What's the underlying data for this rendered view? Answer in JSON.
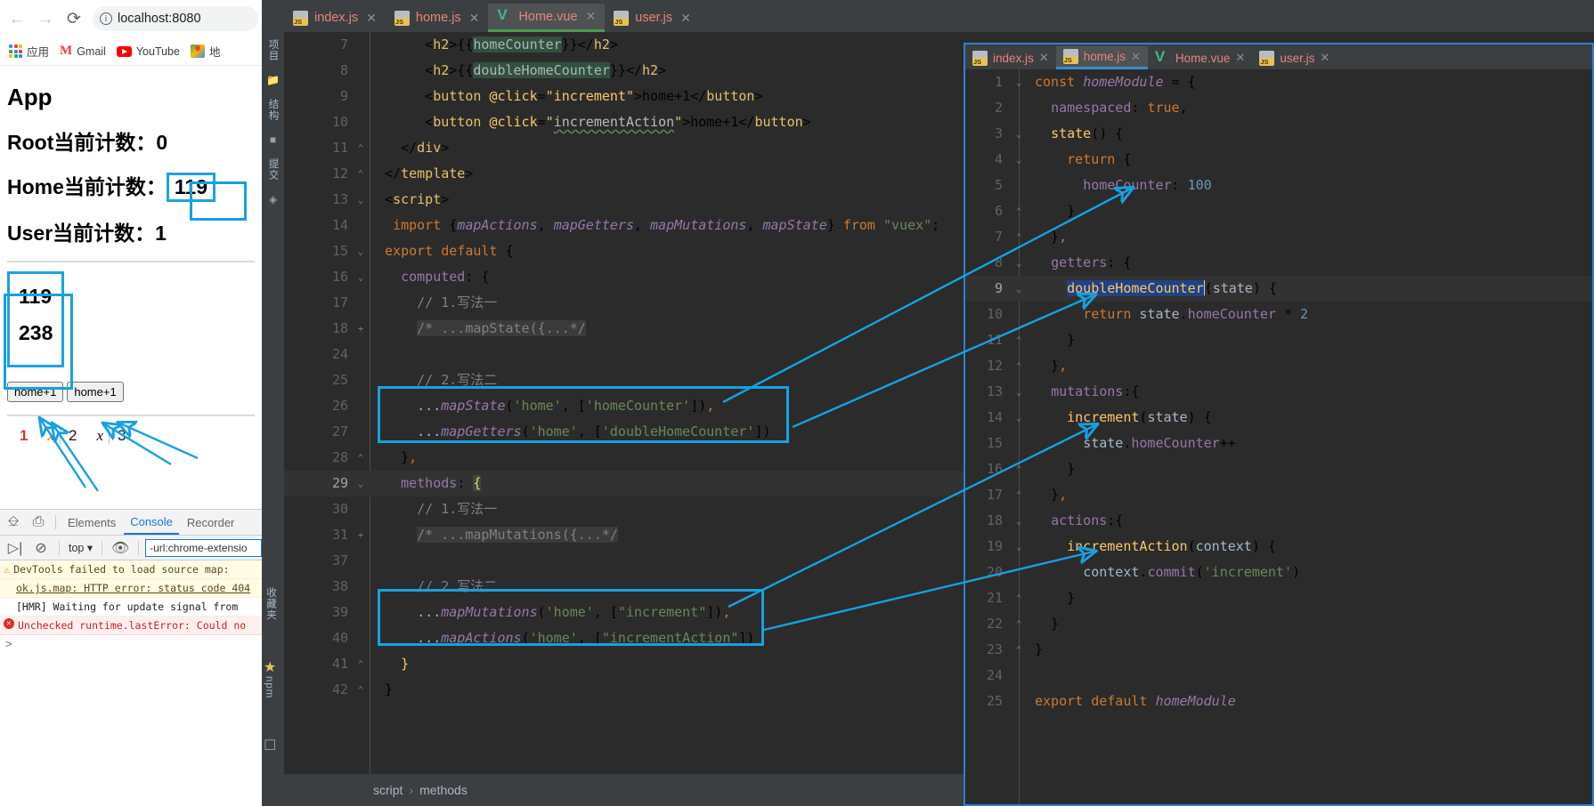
{
  "browser": {
    "nav": {
      "back": "←",
      "forward": "→",
      "reload": "⟳"
    },
    "omnibox": {
      "url": "localhost:8080",
      "info_icon": "info-icon"
    },
    "bookmarks": [
      {
        "label": "应用",
        "icon": "apps-grid-icon"
      },
      {
        "label": "Gmail",
        "icon": "gmail-icon"
      },
      {
        "label": "YouTube",
        "icon": "youtube-icon"
      },
      {
        "label": "地",
        "icon": "google-maps-icon"
      }
    ]
  },
  "page": {
    "app_title": "App",
    "root_counter_label": "Root当前计数：",
    "root_counter_value": "0",
    "home_counter_label": "Home当前计数：",
    "home_counter_value": "119",
    "user_counter_label": "User当前计数：",
    "user_counter_value": "1",
    "home_counter_display": "119",
    "double_home_counter_display": "238",
    "button_1": "home+1",
    "button_2": "home+1",
    "pager": {
      "p1": "1",
      "x1": "x",
      "p2": "2",
      "x2": "x",
      "p3": "3"
    }
  },
  "devtools": {
    "tabs": [
      "Elements",
      "Console",
      "Recorder"
    ],
    "active_tab": "Console",
    "context": "top",
    "filter_value": "-url:chrome-extensio",
    "logs": [
      {
        "level": "warning",
        "text": "DevTools failed to load source map:",
        "text2": "ok.js.map: HTTP error: status code 404"
      },
      {
        "level": "info",
        "text": "[HMR] Waiting for update signal from"
      },
      {
        "level": "error",
        "text": "Unchecked runtime.lastError: Could no"
      }
    ],
    "prompt": ">"
  },
  "ide": {
    "toolstrip": [
      "项目",
      "结构",
      "提交"
    ],
    "right_strip": [
      "收藏夹",
      "npm"
    ],
    "tabs": [
      {
        "label": "index.js",
        "icon": "js-file-icon",
        "active": false
      },
      {
        "label": "home.js",
        "icon": "js-file-icon",
        "active": false
      },
      {
        "label": "Home.vue",
        "icon": "vue-file-icon",
        "active": true
      },
      {
        "label": "user.js",
        "icon": "js-file-icon",
        "active": false
      }
    ],
    "breadcrumb": [
      "script",
      "methods"
    ],
    "editor_lines": [
      {
        "n": "7",
        "fold": "",
        "html": "      &lt;<span class='tag'>h2</span>&gt;{{<span class='id hl-green'>homeCounter</span>}}&lt;/<span class='tag'>h2</span>&gt;"
      },
      {
        "n": "8",
        "fold": "",
        "html": "      &lt;<span class='tag'>h2</span>&gt;{{<span class='id hl-green'>doubleHomeCounter</span>}}&lt;/<span class='tag'>h2</span>&gt;"
      },
      {
        "n": "9",
        "fold": "",
        "html": "      &lt;<span class='tag'>button</span> <span class='fn'>@click</span>=<span class='tag'>\"</span><span class='fn'>increment</span><span class='tag'>\"</span>&gt;home+1&lt;/<span class='tag'>button</span>&gt;"
      },
      {
        "n": "10",
        "fold": "",
        "html": "      &lt;<span class='tag'>button</span> <span class='fn'>@click</span>=<span class='tag'>\"</span><span class='attr squig'>incrementAction</span><span class='tag'>\"</span>&gt;home+1&lt;/<span class='tag'>button</span>&gt;"
      },
      {
        "n": "11",
        "fold": "⌃",
        "html": "   &lt;/<span class='tag'>div</span>&gt;"
      },
      {
        "n": "12",
        "fold": "⌃",
        "html": " &lt;/<span class='tag'>template</span>&gt;"
      },
      {
        "n": "13",
        "fold": "⌄",
        "html": " &lt;<span class='tag'>script</span>&gt;"
      },
      {
        "n": "14",
        "fold": "",
        "html": "  <span class='k'>import</span> {<span class='prop itl'>mapActions</span>, <span class='prop itl'>mapGetters</span>, <span class='prop itl'>mapMutations</span>, <span class='prop itl'>mapState</span>} <span class='k'>from</span> <span class='str'>\"vuex\"</span>;"
      },
      {
        "n": "15",
        "fold": "⌄",
        "html": " <span class='k'>export default</span> {"
      },
      {
        "n": "16",
        "fold": "⌄",
        "html": "   <span class='prop'>computed</span>: {"
      },
      {
        "n": "17",
        "fold": "",
        "html": "     <span class='cmt'>// 1.写法一</span>"
      },
      {
        "n": "18",
        "fold": "+",
        "html": "     <span class='cmt hl-grey'>/* ...mapState({...*/</span>"
      },
      {
        "n": "24",
        "fold": "",
        "html": ""
      },
      {
        "n": "25",
        "fold": "",
        "html": "     <span class='cmt'>// 2.写法二</span>"
      },
      {
        "n": "26",
        "fold": "",
        "html": "     <span class='id'>...</span><span class='prop itl'>mapState</span>(<span class='str'>'home'</span>, [<span class='str'>'homeCounter'</span>])<span class='k'>,</span>"
      },
      {
        "n": "27",
        "fold": "",
        "html": "     <span class='id'>...</span><span class='prop itl'>mapGetters</span>(<span class='str'>'home'</span>, [<span class='str'>'doubleHomeCounter'</span>])"
      },
      {
        "n": "28",
        "fold": "⌃",
        "html": "   }<span class='k'>,</span>"
      },
      {
        "n": "29",
        "fold": "⌄",
        "html": "   <span class='prop'>methods</span>: <span class='fn' style='background:#3a4a3a'>{</span>",
        "current": true
      },
      {
        "n": "30",
        "fold": "",
        "html": "     <span class='cmt'>// 1.写法一</span>"
      },
      {
        "n": "31",
        "fold": "+",
        "html": "     <span class='cmt hl-grey'>/* ...mapMutations({...*/</span>"
      },
      {
        "n": "37",
        "fold": "",
        "html": ""
      },
      {
        "n": "38",
        "fold": "",
        "html": "     <span class='cmt'>// 2.写法二</span>"
      },
      {
        "n": "39",
        "fold": "",
        "html": "     <span class='id'>...</span><span class='prop itl'>mapMutations</span>(<span class='str'>'home'</span>, [<span class='str'>\"increment\"</span>])<span class='k'>,</span>"
      },
      {
        "n": "40",
        "fold": "",
        "html": "     <span class='id'>...</span><span class='prop itl'>mapActions</span>(<span class='str'>'home'</span>, [<span class='str'>\"incrementAction\"</span>])"
      },
      {
        "n": "41",
        "fold": "⌃",
        "html": "   <span class='fn'>}</span>"
      },
      {
        "n": "42",
        "fold": "⌃",
        "html": " }"
      }
    ]
  },
  "floating_window": {
    "tabs": [
      {
        "label": "index.js",
        "icon": "js-file-icon",
        "active": false
      },
      {
        "label": "home.js",
        "icon": "js-file-icon",
        "active": true
      },
      {
        "label": "Home.vue",
        "icon": "vue-file-icon",
        "active": false
      },
      {
        "label": "user.js",
        "icon": "js-file-icon",
        "active": false
      }
    ],
    "lines": [
      {
        "n": "1",
        "fold": "⌄",
        "html": "<span class='k'>const</span> <span class='prop itl'>homeModule</span> = {"
      },
      {
        "n": "2",
        "fold": "",
        "html": "  <span class='prop'>namespaced</span>: <span class='k'>true</span>,"
      },
      {
        "n": "3",
        "fold": "⌄",
        "html": "  <span class='fn'>state</span>() {"
      },
      {
        "n": "4",
        "fold": "⌄",
        "html": "    <span class='k'>return</span> {"
      },
      {
        "n": "5",
        "fold": "",
        "html": "      <span class='prop'>homeCounter</span>: <span class='num'>100</span>"
      },
      {
        "n": "6",
        "fold": "⌃",
        "html": "    }"
      },
      {
        "n": "7",
        "fold": "⌃",
        "html": "  }<span class='k'>,</span>"
      },
      {
        "n": "8",
        "fold": "⌄",
        "html": "  <span class='prop'>getters</span>: {"
      },
      {
        "n": "9",
        "fold": "⌄",
        "html": "    <span class='hl-sel'>doubleHomeCounter</span><span class='caret'></span>(<span class='id'>state</span>) {",
        "current": true
      },
      {
        "n": "10",
        "fold": "",
        "html": "      <span class='k'>return</span> <span class='id'>state</span>.<span class='prop'>homeCounter</span> * <span class='num'>2</span>"
      },
      {
        "n": "11",
        "fold": "⌃",
        "html": "    }"
      },
      {
        "n": "12",
        "fold": "⌃",
        "html": "  }<span class='k'>,</span>"
      },
      {
        "n": "13",
        "fold": "⌄",
        "html": "  <span class='prop'>mutations</span>:{"
      },
      {
        "n": "14",
        "fold": "⌄",
        "html": "    <span class='fn'>increment</span>(<span class='id'>state</span>) {"
      },
      {
        "n": "15",
        "fold": "",
        "html": "      <span class='id'>state</span>.<span class='prop'>homeCounter</span>++"
      },
      {
        "n": "16",
        "fold": "⌃",
        "html": "    }"
      },
      {
        "n": "17",
        "fold": "⌃",
        "html": "  }<span class='k'>,</span>"
      },
      {
        "n": "18",
        "fold": "⌄",
        "html": "  <span class='prop'>actions</span>:{"
      },
      {
        "n": "19",
        "fold": "⌄",
        "html": "    <span class='fn'>incrementAction</span>(<span class='id'>context</span>) {"
      },
      {
        "n": "20",
        "fold": "",
        "html": "      <span class='id'>context</span>.<span class='prop'>commit</span>(<span class='str'>'increment'</span>)"
      },
      {
        "n": "21",
        "fold": "⌃",
        "html": "    }"
      },
      {
        "n": "22",
        "fold": "⌃",
        "html": "  }"
      },
      {
        "n": "23",
        "fold": "⌃",
        "html": "}"
      },
      {
        "n": "24",
        "fold": "",
        "html": ""
      },
      {
        "n": "25",
        "fold": "",
        "html": "<span class='k'>export default</span> <span class='prop itl'>homeModule</span>"
      }
    ]
  },
  "annotation": {
    "color": "#18a0e0"
  }
}
